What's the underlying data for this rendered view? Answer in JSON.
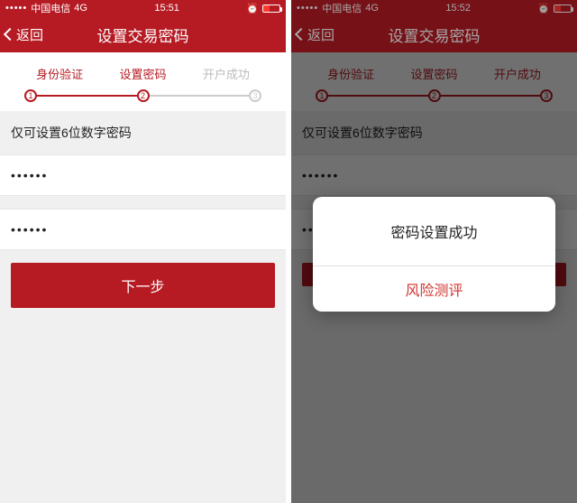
{
  "left": {
    "statusbar": {
      "carrier": "中国电信",
      "network": "4G",
      "time": "15:51"
    },
    "navbar": {
      "back": "返回",
      "title": "设置交易密码"
    },
    "steps": {
      "s1": "身份验证",
      "s2": "设置密码",
      "s3": "开户成功",
      "n1": "1",
      "n2": "2",
      "n3": "3",
      "active": 2
    },
    "hint": "仅可设置6位数字密码",
    "pw1": "••••••",
    "pw2": "••••••",
    "next": "下一步"
  },
  "right": {
    "statusbar": {
      "carrier": "中国电信",
      "network": "4G",
      "time": "15:52"
    },
    "navbar": {
      "back": "返回",
      "title": "设置交易密码"
    },
    "steps": {
      "s1": "身份验证",
      "s2": "设置密码",
      "s3": "开户成功",
      "n1": "1",
      "n2": "2",
      "n3": "3",
      "active": 3
    },
    "hint": "仅可设置6位数字密码",
    "pw1": "••••••",
    "pw2": "••••••",
    "dialog": {
      "msg": "密码设置成功",
      "btn": "风险测评"
    }
  }
}
